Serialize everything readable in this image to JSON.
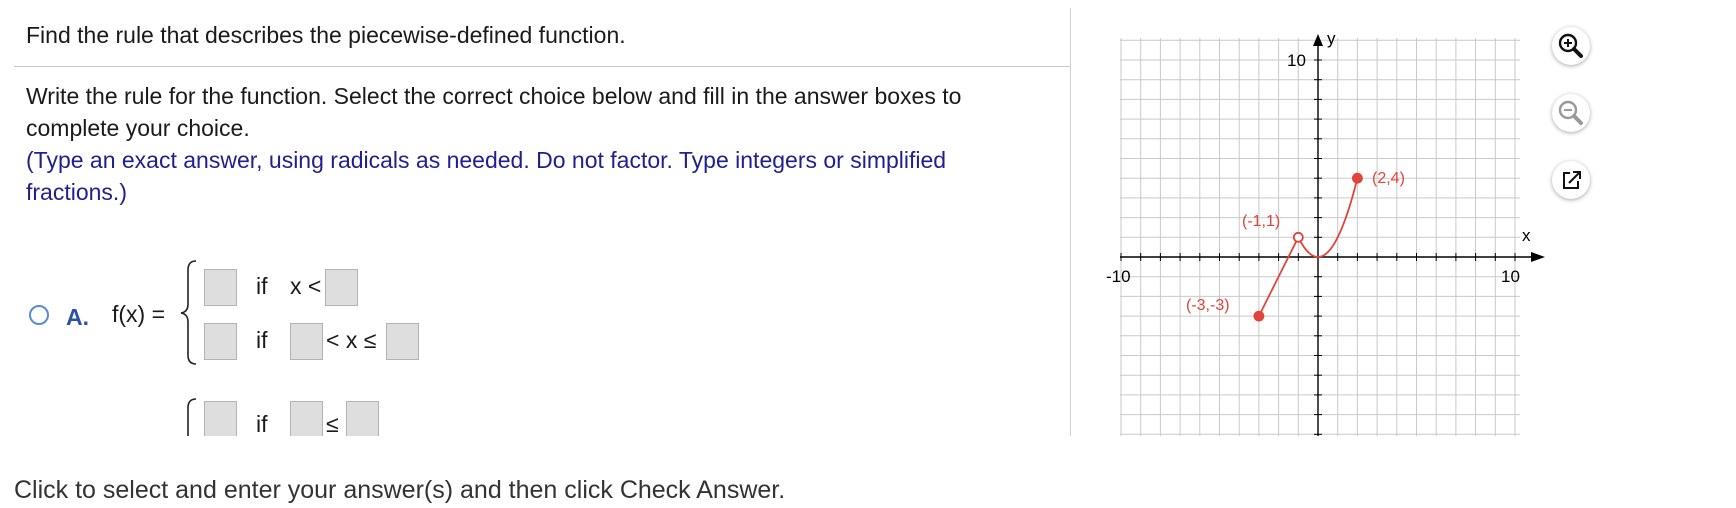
{
  "question": {
    "title": "Find the rule that describes the piecewise-defined function.",
    "instruction": "Write the rule for the function. Select the correct choice below and fill in the answer boxes to complete your choice.",
    "hint": "(Type an exact answer, using radicals as needed. Do not factor. Type integers or simplified fractions.)"
  },
  "choice_a": {
    "letter": "A.",
    "fx": "f(x) =",
    "row1": {
      "if": "if",
      "cond": "x <"
    },
    "row2": {
      "if": "if",
      "lt": "< x ≤"
    }
  },
  "choice_b": {
    "row1": {
      "if": "if",
      "le": "≤"
    }
  },
  "footer": "Click to select and enter your answer(s) and then click Check Answer.",
  "graph": {
    "y_label": "y",
    "x_label": "x",
    "tick_neg10": "-10",
    "tick_10x": "10",
    "tick_10y": "10",
    "point_labels": [
      "(2,4)",
      "(-1,1)",
      "(-3,-3)"
    ],
    "line_color": "#e0443a",
    "points": [
      {
        "x": -3,
        "y": -3,
        "filled": true
      },
      {
        "x": -1,
        "y": 1,
        "filled": false
      },
      {
        "x": 2,
        "y": 4,
        "filled": true
      }
    ]
  },
  "tools": [
    "zoom-in-icon",
    "zoom-out-icon",
    "open-external-icon"
  ]
}
